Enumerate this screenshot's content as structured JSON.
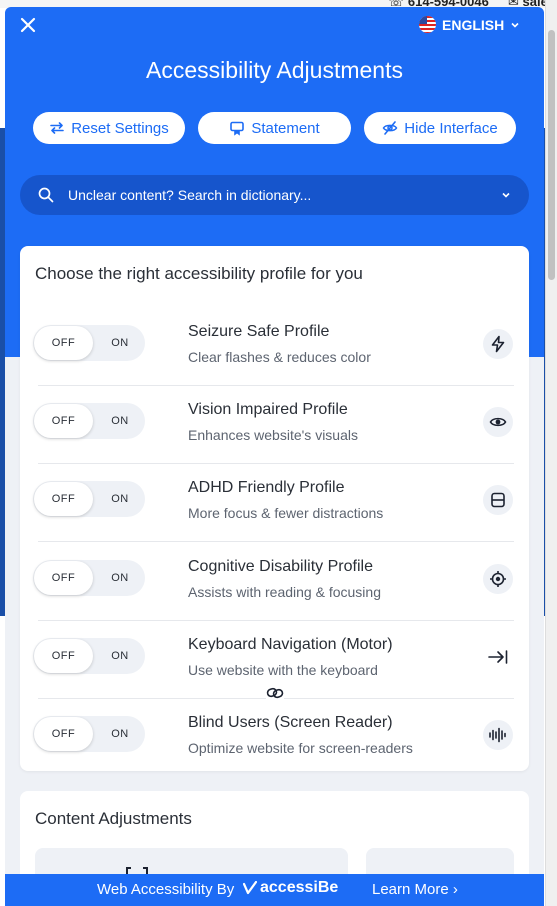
{
  "background": {
    "phone": "614-594-0046",
    "email": "sale"
  },
  "header": {
    "close_label": "Close",
    "language": "ENGLISH",
    "title": "Accessibility Adjustments",
    "buttons": {
      "reset": "Reset Settings",
      "statement": "Statement",
      "hide": "Hide Interface"
    },
    "search_placeholder": "Unclear content? Search in dictionary..."
  },
  "profiles": {
    "heading": "Choose the right accessibility profile for you",
    "toggle_off": "OFF",
    "toggle_on": "ON",
    "items": [
      {
        "title": "Seizure Safe Profile",
        "desc": "Clear flashes & reduces color",
        "icon": "bolt-icon",
        "enabled": false
      },
      {
        "title": "Vision Impaired Profile",
        "desc": "Enhances website's visuals",
        "icon": "eye-icon",
        "enabled": false
      },
      {
        "title": "ADHD Friendly Profile",
        "desc": "More focus & fewer distractions",
        "icon": "focus-window-icon",
        "enabled": false
      },
      {
        "title": "Cognitive Disability Profile",
        "desc": "Assists with reading & focusing",
        "icon": "target-icon",
        "enabled": false
      },
      {
        "title": "Keyboard Navigation (Motor)",
        "desc": "Use website with the keyboard",
        "icon": "tab-arrow-icon",
        "enabled": false
      },
      {
        "title": "Blind Users (Screen Reader)",
        "desc": "Optimize website for screen-readers",
        "icon": "audio-wave-icon",
        "enabled": false
      }
    ]
  },
  "content_adjustments": {
    "heading": "Content Adjustments"
  },
  "footer": {
    "by": "Web Accessibility By",
    "brand": "accessiBe",
    "learn_more": "Learn More ›"
  },
  "colors": {
    "primary": "#1d6cf5",
    "search_bg": "#1655cc",
    "panel_bg": "#eef1f6",
    "text": "#2a2f37"
  }
}
